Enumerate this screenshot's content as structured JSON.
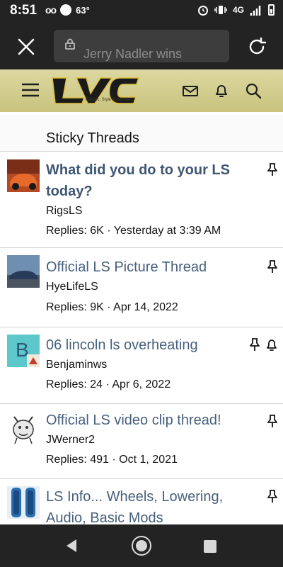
{
  "status_bar": {
    "time": "8:51",
    "voicemail": "oo",
    "temperature": "63°",
    "network": "4G"
  },
  "browser": {
    "url_text": "Jerry Nadler wins"
  },
  "site": {
    "logo_text": "LVC",
    "logo_tagline": "Classic, Style & Attitude"
  },
  "section": {
    "title": "Sticky Threads"
  },
  "threads": [
    {
      "title": "What did you do to your LS today?",
      "author": "RigsLS",
      "meta": "Replies: 6K · Yesterday at 3:39 AM",
      "unread": true
    },
    {
      "title": "Official LS Picture Thread",
      "author": "HyeLifeLS",
      "meta": "Replies: 9K · Apr 14, 2022",
      "unread": false
    },
    {
      "title": "06 lincoln ls overheating",
      "author": "Benjaminws",
      "meta": "Replies: 24 · Apr 6, 2022",
      "unread": false,
      "avatar_letter": "B",
      "watched": true
    },
    {
      "title": "Official LS video clip thread!",
      "author": "JWerner2",
      "meta": "Replies: 491 · Oct 1, 2021",
      "unread": false
    },
    {
      "title": "LS Info... Wheels, Lowering, Audio, Basic Mods",
      "author": "",
      "meta": "",
      "unread": false
    }
  ],
  "colors": {
    "chrome": "#232323",
    "header_gold": "#c9c37e",
    "link": "#47607d"
  }
}
